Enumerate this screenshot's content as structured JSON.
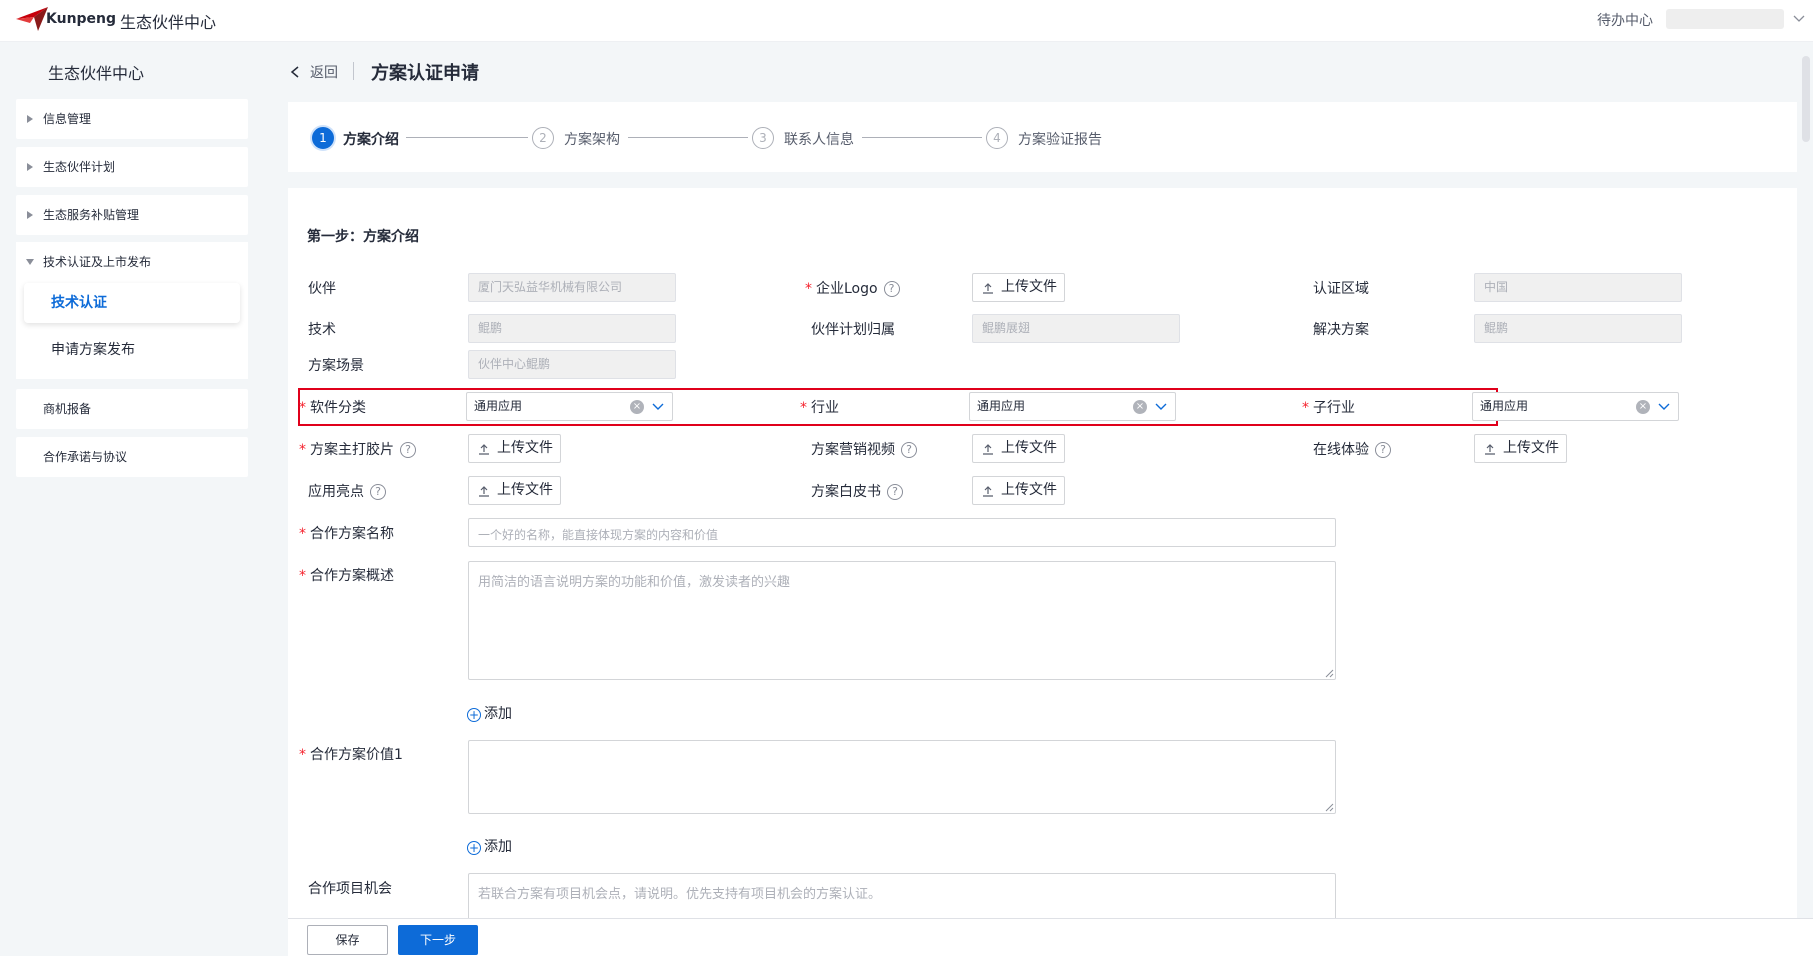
{
  "header": {
    "brand": "Kunpeng",
    "app_title": "生态伙伴中心",
    "todo_center": "待办中心",
    "accent_color": "#0d6bd8",
    "logo_color": "#c7000b"
  },
  "sidebar": {
    "title": "生态伙伴中心",
    "items": [
      {
        "label": "信息管理"
      },
      {
        "label": "生态伙伴计划"
      },
      {
        "label": "生态服务补贴管理"
      }
    ],
    "group": {
      "label": "技术认证及上市发布",
      "children": [
        {
          "label": "技术认证",
          "active": true
        },
        {
          "label": "申请方案发布",
          "active": false
        }
      ]
    },
    "bottom_items": [
      {
        "label": "商机报备"
      },
      {
        "label": "合作承诺与协议"
      }
    ]
  },
  "breadcrumb": {
    "back": "返回",
    "title": "方案认证申请"
  },
  "steps": [
    {
      "num": "1",
      "label": "方案介绍",
      "active": true
    },
    {
      "num": "2",
      "label": "方案架构",
      "active": false
    },
    {
      "num": "3",
      "label": "联系人信息",
      "active": false
    },
    {
      "num": "4",
      "label": "方案验证报告",
      "active": false
    }
  ],
  "form": {
    "section_title": "第一步：方案介绍",
    "partner": {
      "label": "伙伴",
      "value": "厦门天弘益华机械有限公司"
    },
    "logo": {
      "label": "企业Logo",
      "button": "上传文件"
    },
    "region": {
      "label": "认证区域",
      "value": "中国"
    },
    "tech": {
      "label": "技术",
      "value": "鲲鹏"
    },
    "plan": {
      "label": "伙伴计划归属",
      "value": "鲲鹏展翅"
    },
    "solution": {
      "label": "解决方案",
      "value": "鲲鹏"
    },
    "scene": {
      "label": "方案场景",
      "value": "伙伴中心鲲鹏"
    },
    "software_category": {
      "label": "软件分类",
      "value": "通用应用"
    },
    "industry": {
      "label": "行业",
      "value": "通用应用"
    },
    "sub_industry": {
      "label": "子行业",
      "value": "通用应用"
    },
    "main_slide": {
      "label": "方案主打胶片",
      "button": "上传文件"
    },
    "marketing_video": {
      "label": "方案营销视频",
      "button": "上传文件"
    },
    "online_trial": {
      "label": "在线体验",
      "button": "上传文件"
    },
    "highlights": {
      "label": "应用亮点",
      "button": "上传文件"
    },
    "whitepaper": {
      "label": "方案白皮书",
      "button": "上传文件"
    },
    "name": {
      "label": "合作方案名称",
      "placeholder": "一个好的名称，能直接体现方案的内容和价值"
    },
    "overview": {
      "label": "合作方案概述",
      "placeholder": "用简洁的语言说明方案的功能和价值，激发读者的兴趣"
    },
    "add_1": "添加",
    "value1": {
      "label": "合作方案价值1",
      "placeholder": ""
    },
    "add_2": "添加",
    "opportunity": {
      "label": "合作项目机会",
      "placeholder": "若联合方案有项目机会点，请说明。优先支持有项目机会的方案认证。"
    }
  },
  "footer": {
    "save": "保存",
    "next": "下一步"
  }
}
